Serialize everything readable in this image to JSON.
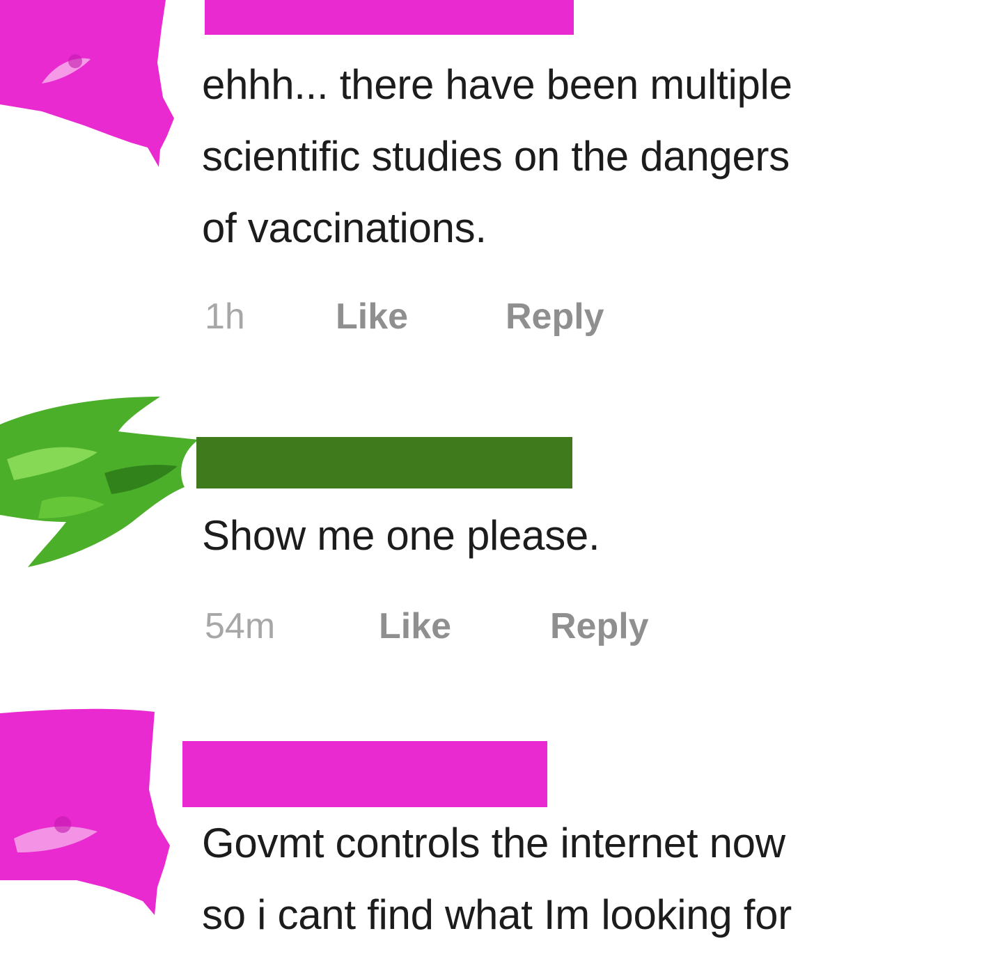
{
  "colors": {
    "redaction_magenta": "#e92ad0",
    "redaction_green": "#3f7a1c",
    "avatar_green": "#4caf2a",
    "text": "#1c1c1c",
    "meta": "#a7a7a7"
  },
  "comments": [
    {
      "avatar": "redacted-magenta",
      "lines": [
        "ehhh... there have been multiple",
        "scientific studies on the dangers",
        "of vaccinations."
      ],
      "time": "1h",
      "like": "Like",
      "reply": "Reply"
    },
    {
      "avatar": "redacted-green",
      "lines": [
        "Show me one please."
      ],
      "time": "54m",
      "like": "Like",
      "reply": "Reply"
    },
    {
      "avatar": "redacted-magenta",
      "lines": [
        "Govmt controls the internet now",
        "so i cant find what Im looking for"
      ]
    }
  ]
}
